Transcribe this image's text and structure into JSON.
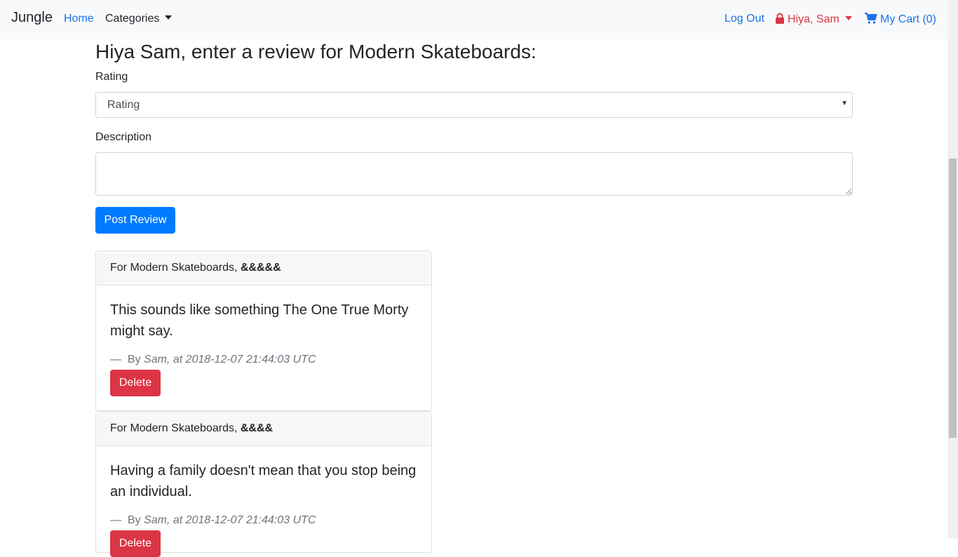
{
  "nav": {
    "brand": "Jungle",
    "home": "Home",
    "categories": "Categories",
    "logout": "Log Out",
    "user": "Hiya, Sam",
    "cart": "My Cart (0)"
  },
  "form": {
    "heading": "Hiya Sam, enter a review for Modern Skateboards:",
    "rating_label": "Rating",
    "rating_selected": "Rating",
    "description_label": "Description",
    "description_value": "",
    "submit": "Post Review"
  },
  "reviews": [
    {
      "header": "For Modern Skateboards,",
      "stars": "&&&&&",
      "text": "This sounds like something The One True Morty might say.",
      "dash": "—",
      "by": "By",
      "meta": "Sam, at 2018-12-07 21:44:03 UTC",
      "delete": "Delete"
    },
    {
      "header": "For Modern Skateboards,",
      "stars": "&&&&",
      "text": "Having a family doesn't mean that you stop being an individual.",
      "dash": "—",
      "by": "By",
      "meta": "Sam, at 2018-12-07 21:44:03 UTC",
      "delete": "Delete"
    }
  ],
  "colors": {
    "link": "#1a73e8",
    "danger": "#dc3545",
    "primary": "#007bff"
  }
}
